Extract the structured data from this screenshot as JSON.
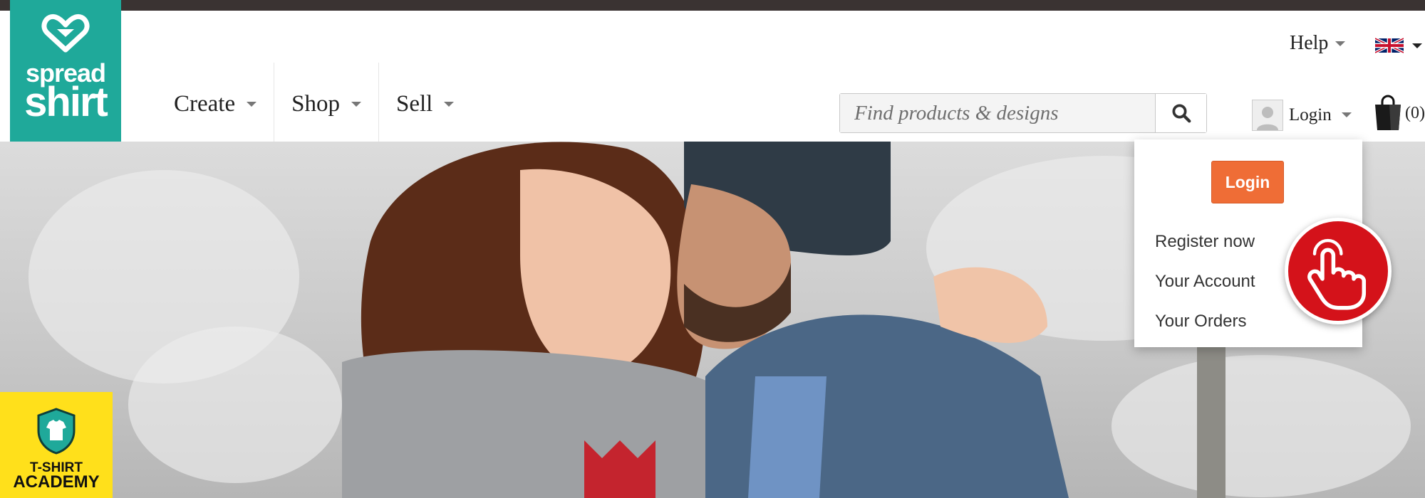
{
  "brand": {
    "line1": "spread",
    "line2": "shirt",
    "color": "#1fa99a"
  },
  "utility": {
    "help_label": "Help",
    "language_icon": "uk-flag-icon"
  },
  "nav": [
    {
      "label": "Create"
    },
    {
      "label": "Shop"
    },
    {
      "label": "Sell"
    }
  ],
  "search": {
    "placeholder": "Find products & designs",
    "icon": "search-icon"
  },
  "account": {
    "label": "Login",
    "icon": "avatar-placeholder-icon"
  },
  "cart": {
    "count": "(0)",
    "icon": "shopping-bag-icon"
  },
  "dropdown": {
    "login_button": "Login",
    "links": [
      "Register now",
      "Your Account",
      "Your Orders"
    ],
    "button_color": "#ef6d36"
  },
  "badge": {
    "line1": "T-SHIRT",
    "line2": "ACADEMY",
    "color": "#ffe01b"
  },
  "cursor": {
    "icon": "pointing-hand-icon",
    "color": "#d4121a"
  }
}
